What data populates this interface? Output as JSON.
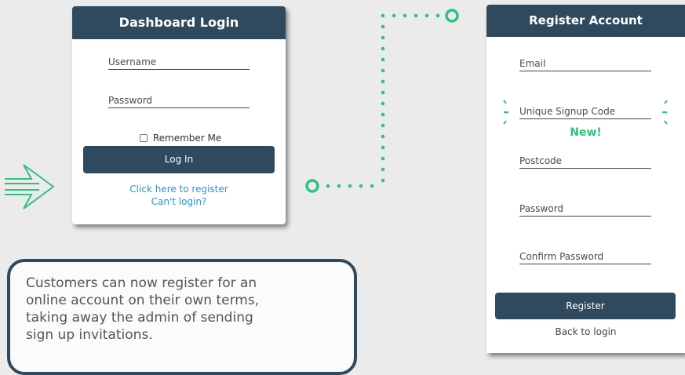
{
  "login": {
    "title": "Dashboard Login",
    "username_placeholder": "Username",
    "password_placeholder": "Password",
    "remember_label": "Remember Me",
    "login_button": "Log In",
    "register_link": "Click here to register",
    "cant_login_link": "Can't login?"
  },
  "register": {
    "title": "Register Account",
    "email_placeholder": "Email",
    "signup_code_placeholder": "Unique Signup Code",
    "new_badge": "New!",
    "postcode_placeholder": "Postcode",
    "password_placeholder": "Password",
    "confirm_password_placeholder": "Confirm Password",
    "register_button": "Register",
    "back_link": "Back to login"
  },
  "callout": {
    "text": "Customers can now register for an online account on their own terms, taking away the admin of sending sign up invitations."
  },
  "colors": {
    "header": "#2f4a5e",
    "accent_green": "#2ec27e",
    "link_blue": "#2f8fd8"
  }
}
